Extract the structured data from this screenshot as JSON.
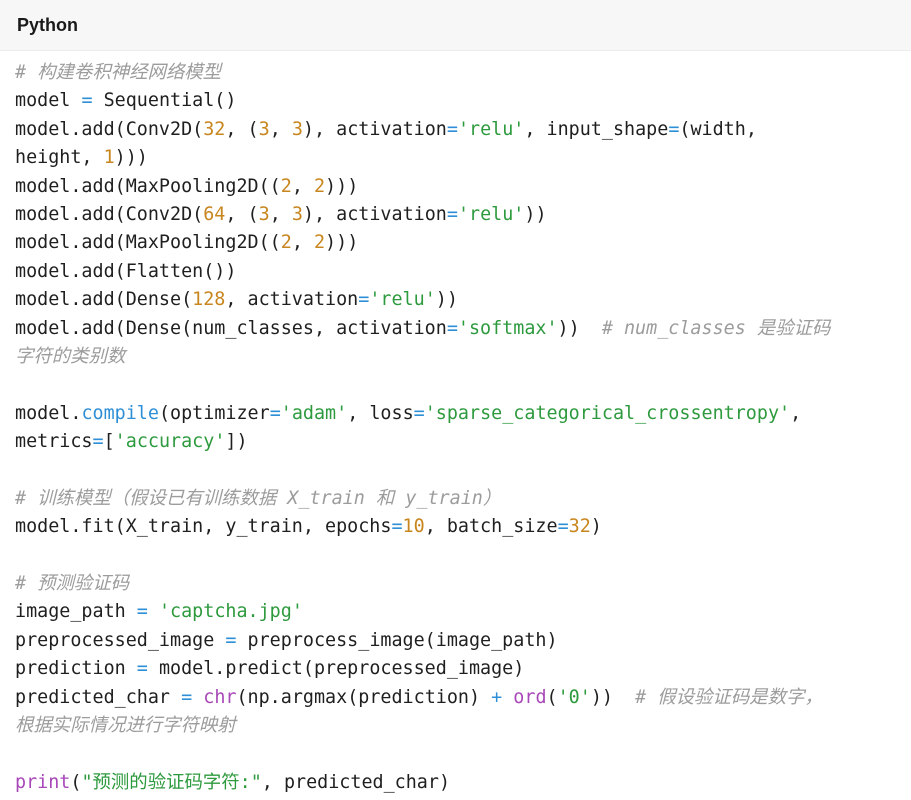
{
  "header": {
    "language_label": "Python"
  },
  "colors": {
    "plain": "#1f1f1f",
    "comment": "#9c9c9c",
    "operator": "#2f8fd6",
    "number": "#c8861e",
    "string": "#2e9a3e",
    "keyword": "#2f8fd6",
    "builtin": "#a848b8",
    "header_bg": "#f7f7f7"
  },
  "code_lines": [
    [
      {
        "t": "comment",
        "v": "# 构建卷积神经网络模型"
      }
    ],
    [
      {
        "t": "plain",
        "v": "model "
      },
      {
        "t": "op",
        "v": "="
      },
      {
        "t": "plain",
        "v": " Sequential()"
      }
    ],
    [
      {
        "t": "plain",
        "v": "model.add(Conv2D("
      },
      {
        "t": "num",
        "v": "32"
      },
      {
        "t": "plain",
        "v": ", ("
      },
      {
        "t": "num",
        "v": "3"
      },
      {
        "t": "plain",
        "v": ", "
      },
      {
        "t": "num",
        "v": "3"
      },
      {
        "t": "plain",
        "v": "), activation"
      },
      {
        "t": "op",
        "v": "="
      },
      {
        "t": "str",
        "v": "'relu'"
      },
      {
        "t": "plain",
        "v": ", input_shape"
      },
      {
        "t": "op",
        "v": "="
      },
      {
        "t": "plain",
        "v": "(width,"
      }
    ],
    [
      {
        "t": "plain",
        "v": "height, "
      },
      {
        "t": "num",
        "v": "1"
      },
      {
        "t": "plain",
        "v": ")))"
      }
    ],
    [
      {
        "t": "plain",
        "v": "model.add(MaxPooling2D(("
      },
      {
        "t": "num",
        "v": "2"
      },
      {
        "t": "plain",
        "v": ", "
      },
      {
        "t": "num",
        "v": "2"
      },
      {
        "t": "plain",
        "v": ")))"
      }
    ],
    [
      {
        "t": "plain",
        "v": "model.add(Conv2D("
      },
      {
        "t": "num",
        "v": "64"
      },
      {
        "t": "plain",
        "v": ", ("
      },
      {
        "t": "num",
        "v": "3"
      },
      {
        "t": "plain",
        "v": ", "
      },
      {
        "t": "num",
        "v": "3"
      },
      {
        "t": "plain",
        "v": "), activation"
      },
      {
        "t": "op",
        "v": "="
      },
      {
        "t": "str",
        "v": "'relu'"
      },
      {
        "t": "plain",
        "v": "))"
      }
    ],
    [
      {
        "t": "plain",
        "v": "model.add(MaxPooling2D(("
      },
      {
        "t": "num",
        "v": "2"
      },
      {
        "t": "plain",
        "v": ", "
      },
      {
        "t": "num",
        "v": "2"
      },
      {
        "t": "plain",
        "v": ")))"
      }
    ],
    [
      {
        "t": "plain",
        "v": "model.add(Flatten())"
      }
    ],
    [
      {
        "t": "plain",
        "v": "model.add(Dense("
      },
      {
        "t": "num",
        "v": "128"
      },
      {
        "t": "plain",
        "v": ", activation"
      },
      {
        "t": "op",
        "v": "="
      },
      {
        "t": "str",
        "v": "'relu'"
      },
      {
        "t": "plain",
        "v": "))"
      }
    ],
    [
      {
        "t": "plain",
        "v": "model.add(Dense(num_classes, activation"
      },
      {
        "t": "op",
        "v": "="
      },
      {
        "t": "str",
        "v": "'softmax'"
      },
      {
        "t": "plain",
        "v": "))  "
      },
      {
        "t": "comment",
        "v": "# num_classes 是验证码"
      }
    ],
    [
      {
        "t": "comment",
        "v": "字符的类别数"
      }
    ],
    [],
    [
      {
        "t": "plain",
        "v": "model."
      },
      {
        "t": "kw",
        "v": "compile"
      },
      {
        "t": "plain",
        "v": "(optimizer"
      },
      {
        "t": "op",
        "v": "="
      },
      {
        "t": "str",
        "v": "'adam'"
      },
      {
        "t": "plain",
        "v": ", loss"
      },
      {
        "t": "op",
        "v": "="
      },
      {
        "t": "str",
        "v": "'sparse_categorical_crossentropy'"
      },
      {
        "t": "plain",
        "v": ","
      }
    ],
    [
      {
        "t": "plain",
        "v": "metrics"
      },
      {
        "t": "op",
        "v": "="
      },
      {
        "t": "plain",
        "v": "["
      },
      {
        "t": "str",
        "v": "'accuracy'"
      },
      {
        "t": "plain",
        "v": "])"
      }
    ],
    [],
    [
      {
        "t": "comment",
        "v": "# 训练模型（假设已有训练数据 X_train 和 y_train）"
      }
    ],
    [
      {
        "t": "plain",
        "v": "model.fit(X_train, y_train, epochs"
      },
      {
        "t": "op",
        "v": "="
      },
      {
        "t": "num",
        "v": "10"
      },
      {
        "t": "plain",
        "v": ", batch_size"
      },
      {
        "t": "op",
        "v": "="
      },
      {
        "t": "num",
        "v": "32"
      },
      {
        "t": "plain",
        "v": ")"
      }
    ],
    [],
    [
      {
        "t": "comment",
        "v": "# 预测验证码"
      }
    ],
    [
      {
        "t": "plain",
        "v": "image_path "
      },
      {
        "t": "op",
        "v": "="
      },
      {
        "t": "plain",
        "v": " "
      },
      {
        "t": "str",
        "v": "'captcha.jpg'"
      }
    ],
    [
      {
        "t": "plain",
        "v": "preprocessed_image "
      },
      {
        "t": "op",
        "v": "="
      },
      {
        "t": "plain",
        "v": " preprocess_image(image_path)"
      }
    ],
    [
      {
        "t": "plain",
        "v": "prediction "
      },
      {
        "t": "op",
        "v": "="
      },
      {
        "t": "plain",
        "v": " model.predict(preprocessed_image)"
      }
    ],
    [
      {
        "t": "plain",
        "v": "predicted_char "
      },
      {
        "t": "op",
        "v": "="
      },
      {
        "t": "plain",
        "v": " "
      },
      {
        "t": "builtin",
        "v": "chr"
      },
      {
        "t": "plain",
        "v": "(np.argmax(prediction) "
      },
      {
        "t": "op",
        "v": "+"
      },
      {
        "t": "plain",
        "v": " "
      },
      {
        "t": "builtin",
        "v": "ord"
      },
      {
        "t": "plain",
        "v": "("
      },
      {
        "t": "str",
        "v": "'0'"
      },
      {
        "t": "plain",
        "v": "))  "
      },
      {
        "t": "comment",
        "v": "# 假设验证码是数字，"
      }
    ],
    [
      {
        "t": "comment",
        "v": "根据实际情况进行字符映射"
      }
    ],
    [],
    [
      {
        "t": "builtin",
        "v": "print"
      },
      {
        "t": "plain",
        "v": "("
      },
      {
        "t": "str",
        "v": "\"预测的验证码字符:\""
      },
      {
        "t": "plain",
        "v": ", predicted_char)"
      }
    ]
  ]
}
